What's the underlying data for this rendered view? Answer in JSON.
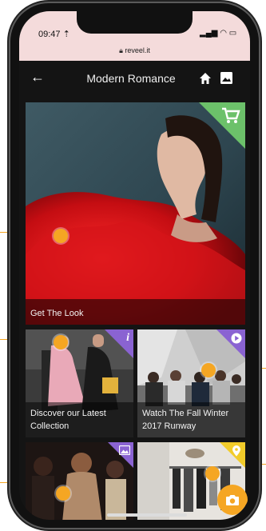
{
  "status": {
    "time": "09:47 ⇡",
    "url": "reveel.it"
  },
  "nav": {
    "title": "Modern Romance"
  },
  "tiles": {
    "hero": {
      "label": "Get The Look"
    },
    "discover": {
      "label": "Discover our Latest Collection"
    },
    "runway": {
      "label": "Watch The Fall Winter 2017 Runway"
    }
  },
  "icons": {
    "back": "arrow-left-icon",
    "home": "home-icon",
    "gallery": "gallery-icon",
    "cart": "shopping-cart-icon",
    "info": "info-icon",
    "play": "play-icon",
    "image": "image-icon",
    "location": "location-pin-icon",
    "camera": "camera-icon"
  },
  "colors": {
    "accent": "#f5a623",
    "cart_corner": "#6cc16a",
    "info_corner": "#8a63d2",
    "play_corner": "#8a63d2",
    "image_corner": "#8a63d2",
    "location_corner": "#f2cc2a"
  }
}
